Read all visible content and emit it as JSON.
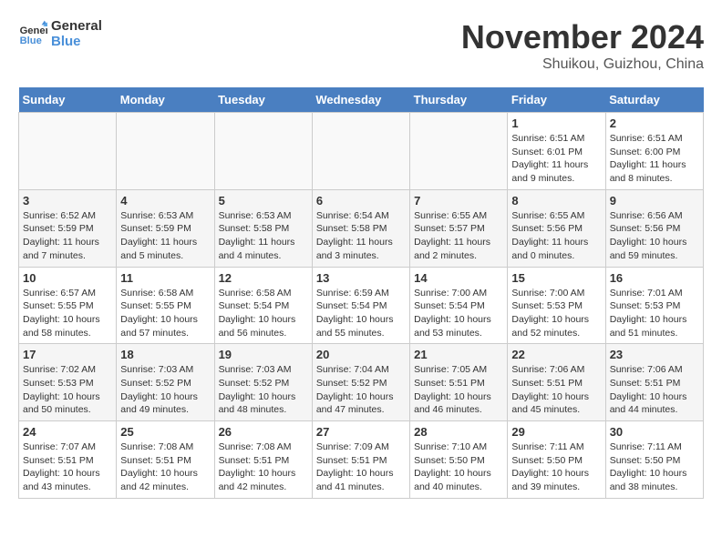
{
  "logo": {
    "line1": "General",
    "line2": "Blue"
  },
  "title": "November 2024",
  "subtitle": "Shuikou, Guizhou, China",
  "weekdays": [
    "Sunday",
    "Monday",
    "Tuesday",
    "Wednesday",
    "Thursday",
    "Friday",
    "Saturday"
  ],
  "weeks": [
    [
      {
        "day": "",
        "info": ""
      },
      {
        "day": "",
        "info": ""
      },
      {
        "day": "",
        "info": ""
      },
      {
        "day": "",
        "info": ""
      },
      {
        "day": "",
        "info": ""
      },
      {
        "day": "1",
        "info": "Sunrise: 6:51 AM\nSunset: 6:01 PM\nDaylight: 11 hours and 9 minutes."
      },
      {
        "day": "2",
        "info": "Sunrise: 6:51 AM\nSunset: 6:00 PM\nDaylight: 11 hours and 8 minutes."
      }
    ],
    [
      {
        "day": "3",
        "info": "Sunrise: 6:52 AM\nSunset: 5:59 PM\nDaylight: 11 hours and 7 minutes."
      },
      {
        "day": "4",
        "info": "Sunrise: 6:53 AM\nSunset: 5:59 PM\nDaylight: 11 hours and 5 minutes."
      },
      {
        "day": "5",
        "info": "Sunrise: 6:53 AM\nSunset: 5:58 PM\nDaylight: 11 hours and 4 minutes."
      },
      {
        "day": "6",
        "info": "Sunrise: 6:54 AM\nSunset: 5:58 PM\nDaylight: 11 hours and 3 minutes."
      },
      {
        "day": "7",
        "info": "Sunrise: 6:55 AM\nSunset: 5:57 PM\nDaylight: 11 hours and 2 minutes."
      },
      {
        "day": "8",
        "info": "Sunrise: 6:55 AM\nSunset: 5:56 PM\nDaylight: 11 hours and 0 minutes."
      },
      {
        "day": "9",
        "info": "Sunrise: 6:56 AM\nSunset: 5:56 PM\nDaylight: 10 hours and 59 minutes."
      }
    ],
    [
      {
        "day": "10",
        "info": "Sunrise: 6:57 AM\nSunset: 5:55 PM\nDaylight: 10 hours and 58 minutes."
      },
      {
        "day": "11",
        "info": "Sunrise: 6:58 AM\nSunset: 5:55 PM\nDaylight: 10 hours and 57 minutes."
      },
      {
        "day": "12",
        "info": "Sunrise: 6:58 AM\nSunset: 5:54 PM\nDaylight: 10 hours and 56 minutes."
      },
      {
        "day": "13",
        "info": "Sunrise: 6:59 AM\nSunset: 5:54 PM\nDaylight: 10 hours and 55 minutes."
      },
      {
        "day": "14",
        "info": "Sunrise: 7:00 AM\nSunset: 5:54 PM\nDaylight: 10 hours and 53 minutes."
      },
      {
        "day": "15",
        "info": "Sunrise: 7:00 AM\nSunset: 5:53 PM\nDaylight: 10 hours and 52 minutes."
      },
      {
        "day": "16",
        "info": "Sunrise: 7:01 AM\nSunset: 5:53 PM\nDaylight: 10 hours and 51 minutes."
      }
    ],
    [
      {
        "day": "17",
        "info": "Sunrise: 7:02 AM\nSunset: 5:53 PM\nDaylight: 10 hours and 50 minutes."
      },
      {
        "day": "18",
        "info": "Sunrise: 7:03 AM\nSunset: 5:52 PM\nDaylight: 10 hours and 49 minutes."
      },
      {
        "day": "19",
        "info": "Sunrise: 7:03 AM\nSunset: 5:52 PM\nDaylight: 10 hours and 48 minutes."
      },
      {
        "day": "20",
        "info": "Sunrise: 7:04 AM\nSunset: 5:52 PM\nDaylight: 10 hours and 47 minutes."
      },
      {
        "day": "21",
        "info": "Sunrise: 7:05 AM\nSunset: 5:51 PM\nDaylight: 10 hours and 46 minutes."
      },
      {
        "day": "22",
        "info": "Sunrise: 7:06 AM\nSunset: 5:51 PM\nDaylight: 10 hours and 45 minutes."
      },
      {
        "day": "23",
        "info": "Sunrise: 7:06 AM\nSunset: 5:51 PM\nDaylight: 10 hours and 44 minutes."
      }
    ],
    [
      {
        "day": "24",
        "info": "Sunrise: 7:07 AM\nSunset: 5:51 PM\nDaylight: 10 hours and 43 minutes."
      },
      {
        "day": "25",
        "info": "Sunrise: 7:08 AM\nSunset: 5:51 PM\nDaylight: 10 hours and 42 minutes."
      },
      {
        "day": "26",
        "info": "Sunrise: 7:08 AM\nSunset: 5:51 PM\nDaylight: 10 hours and 42 minutes."
      },
      {
        "day": "27",
        "info": "Sunrise: 7:09 AM\nSunset: 5:51 PM\nDaylight: 10 hours and 41 minutes."
      },
      {
        "day": "28",
        "info": "Sunrise: 7:10 AM\nSunset: 5:50 PM\nDaylight: 10 hours and 40 minutes."
      },
      {
        "day": "29",
        "info": "Sunrise: 7:11 AM\nSunset: 5:50 PM\nDaylight: 10 hours and 39 minutes."
      },
      {
        "day": "30",
        "info": "Sunrise: 7:11 AM\nSunset: 5:50 PM\nDaylight: 10 hours and 38 minutes."
      }
    ]
  ]
}
